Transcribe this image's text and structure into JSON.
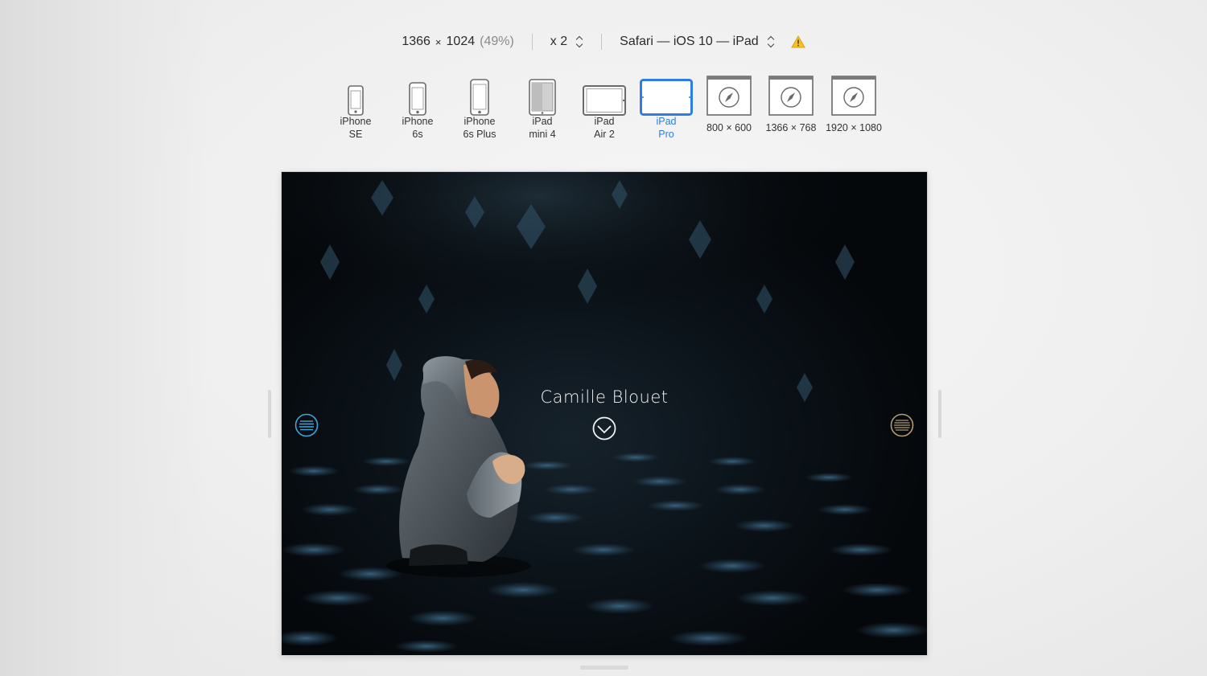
{
  "infobar": {
    "width": "1366",
    "times": "×",
    "height": "1024",
    "scale_percent": "(49%)",
    "pixel_ratio": "x 2",
    "user_agent": "Safari — iOS 10 — iPad",
    "warning_icon": "warning-triangle-icon"
  },
  "devices": [
    {
      "line1": "iPhone",
      "line2": "SE",
      "icon": "phone-small-icon",
      "selected": false
    },
    {
      "line1": "iPhone",
      "line2": "6s",
      "icon": "phone-icon",
      "selected": false
    },
    {
      "line1": "iPhone",
      "line2": "6s Plus",
      "icon": "phone-large-icon",
      "selected": false
    },
    {
      "line1": "iPad",
      "line2": "mini 4",
      "icon": "ipad-mini-icon",
      "selected": false
    },
    {
      "line1": "iPad",
      "line2": "Air 2",
      "icon": "ipad-landscape-icon",
      "selected": false
    },
    {
      "line1": "iPad",
      "line2": "Pro",
      "icon": "ipad-pro-icon",
      "selected": true
    },
    {
      "line1": "800 × 600",
      "icon": "browser-window-icon",
      "selected": false
    },
    {
      "line1": "1366 × 768",
      "icon": "browser-window-icon",
      "selected": false
    },
    {
      "line1": "1920 × 1080",
      "icon": "browser-window-icon",
      "selected": false
    }
  ],
  "viewport": {
    "site_title": "Camille Blouet",
    "menu_left_color": "#3ea6dc",
    "menu_right_color": "#b59a72",
    "accent": "#2e7ce6"
  }
}
